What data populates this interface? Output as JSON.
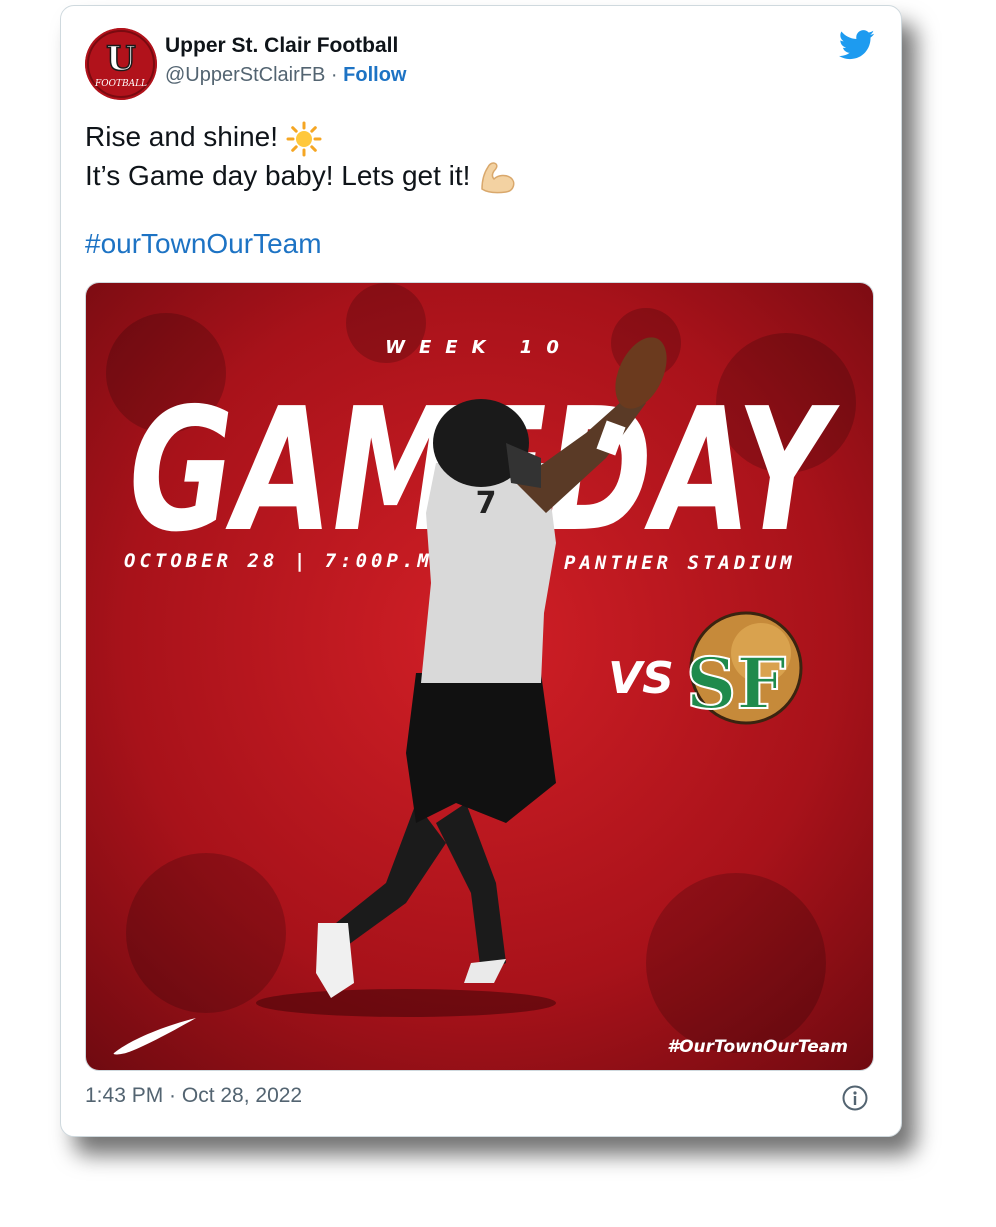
{
  "tweet": {
    "author_name": "Upper St. Clair Football",
    "author_handle": "@UpperStClairFB",
    "separator": "·",
    "follow_label": "Follow",
    "line1": "Rise and shine!",
    "line2": "It’s Game day baby! Lets get it!",
    "hashtag": "#ourTownOurTeam",
    "timestamp": "1:43 PM · Oct 28, 2022"
  },
  "avatar": {
    "letter": "U",
    "script": "FOOTBALL"
  },
  "graphic": {
    "week": "WEEK 10",
    "headline": "GAMEDAY",
    "date_time": "OCTOBER 28 | 7:00P.M.",
    "venue": "PANTHER STADIUM",
    "vs": "VS",
    "opponent_letters": "SF",
    "jersey_number": "7",
    "hashtag": "#OurTownOurTeam"
  },
  "icons": {
    "twitter": "twitter-bird-icon",
    "sun": "sun-emoji",
    "bicep": "flexed-biceps-emoji",
    "info": "info-icon",
    "nike": "nike-swoosh-logo"
  },
  "colors": {
    "link": "#1d73c4",
    "twitter_blue": "#1d9bf0",
    "graphic_red": "#b3141c",
    "opponent_green": "#1f8a4c"
  }
}
